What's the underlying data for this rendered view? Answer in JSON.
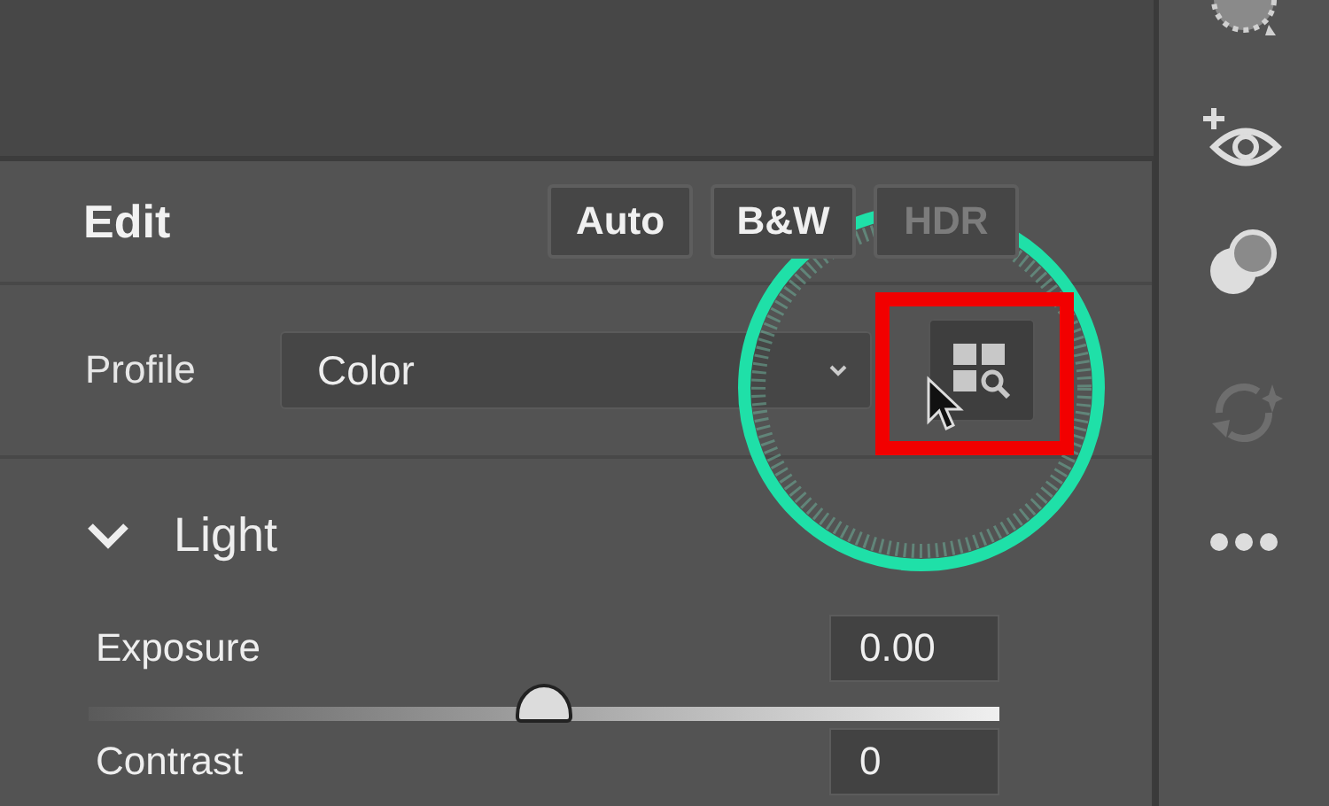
{
  "panel": {
    "title": "Edit",
    "buttons": [
      {
        "label": "Auto",
        "disabled": false
      },
      {
        "label": "B&W",
        "disabled": false
      },
      {
        "label": "HDR",
        "disabled": true
      }
    ],
    "profile": {
      "label": "Profile",
      "value": "Color"
    },
    "section": {
      "title": "Light",
      "expanded": true,
      "sliders": [
        {
          "label": "Exposure",
          "value": "0.00",
          "level": 0.5
        },
        {
          "label": "Contrast",
          "value": "0"
        }
      ]
    }
  },
  "toolbar_icons": [
    {
      "kind": "mask",
      "disabled": false
    },
    {
      "kind": "eye",
      "disabled": false
    },
    {
      "kind": "circles",
      "disabled": false
    },
    {
      "kind": "refresh",
      "disabled": true
    },
    {
      "kind": "more",
      "disabled": false
    }
  ]
}
